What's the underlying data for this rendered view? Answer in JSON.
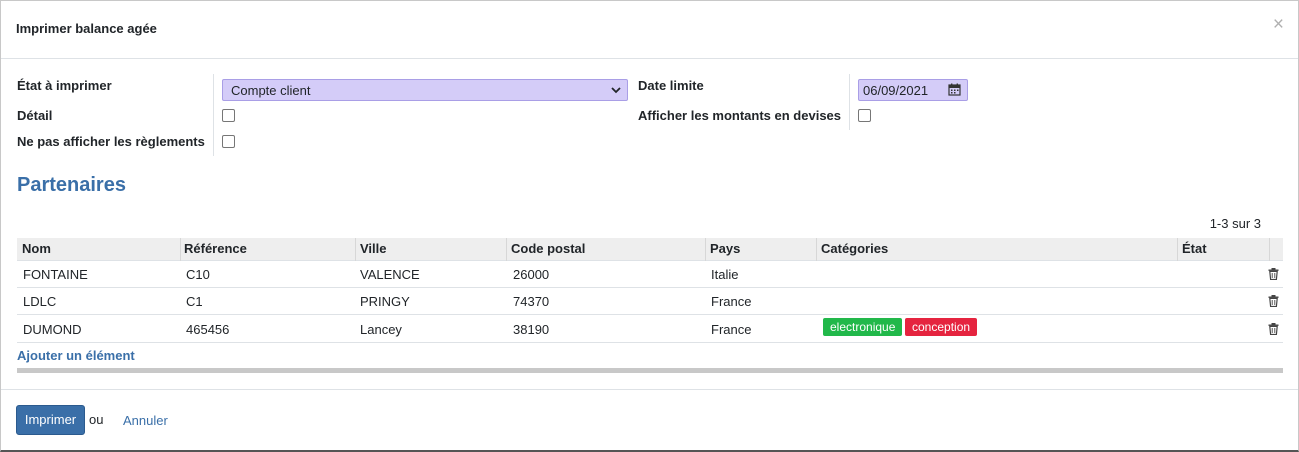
{
  "dialog": {
    "title": "Imprimer balance agée",
    "close_glyph": "×"
  },
  "form": {
    "state_label": "État à imprimer",
    "state_value": "Compte client",
    "detail_label": "Détail",
    "hide_payments_label": "Ne pas afficher les règlements",
    "date_label": "Date limite",
    "date_value": "06/09/2021",
    "currency_label": "Afficher les montants en devises"
  },
  "partners": {
    "section_title": "Partenaires",
    "pager": "1-3 sur 3",
    "columns": [
      "Nom",
      "Référence",
      "Ville",
      "Code postal",
      "Pays",
      "Catégories",
      "État"
    ],
    "rows": [
      {
        "name": "FONTAINE",
        "ref": "C10",
        "city": "VALENCE",
        "zip": "26000",
        "country": "Italie",
        "tags": []
      },
      {
        "name": "LDLC",
        "ref": "C1",
        "city": "PRINGY",
        "zip": "74370",
        "country": "France",
        "tags": []
      },
      {
        "name": "DUMOND",
        "ref": "465456",
        "city": "Lancey",
        "zip": "38190",
        "country": "France",
        "tags": [
          "electronique",
          "conception"
        ]
      }
    ],
    "tag_colors": {
      "electronique": "#21b84a",
      "conception": "#e5243f"
    },
    "add_line": "Ajouter un élément"
  },
  "footer": {
    "print_label": "Imprimer",
    "or_text": "ou",
    "cancel_label": "Annuler"
  },
  "colors": {
    "accent": "#3a6fa8",
    "required_field_bg": "#d4ccf8"
  }
}
